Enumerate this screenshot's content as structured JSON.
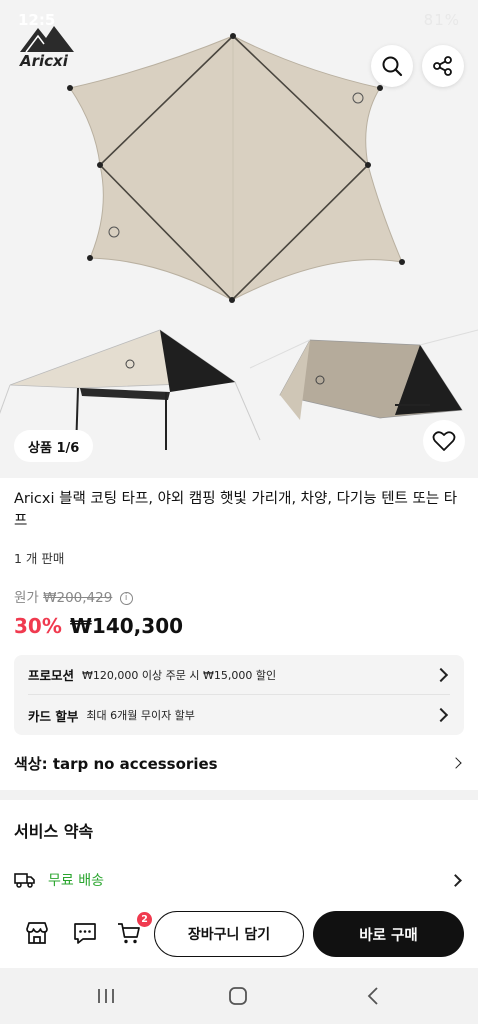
{
  "status_bar": {
    "time": "12:5",
    "right": "81%"
  },
  "brand": {
    "logo_text": "Aricxi"
  },
  "gallery": {
    "counter": "상품 1/6"
  },
  "product": {
    "title": "Aricxi 블랙 코팅 타프, 야외 캠핑 햇빛 가리개, 차양, 다기능 텐트 또는 타프",
    "sold": "1 개 판매",
    "original_label": "원가",
    "original_price": "₩200,429",
    "discount": "30%",
    "price": "₩140,300"
  },
  "promotions": [
    {
      "label": "프로모션",
      "text": "₩120,000 이상 주문 시 ₩15,000 할인"
    },
    {
      "label": "카드 할부",
      "text": "최대 6개월 무이자 할부"
    }
  ],
  "option": {
    "label": "색상: tarp no accessories"
  },
  "service": {
    "title": "서비스 약속",
    "shipping_label": "무료 배송"
  },
  "actions": {
    "cart_count": "2",
    "add_to_cart": "장바구니 담기",
    "buy_now": "바로 구매"
  },
  "icons": [
    "back-icon",
    "search-icon",
    "share-icon",
    "heart-icon",
    "store-icon",
    "chat-icon",
    "cart-icon",
    "truck-icon",
    "chevron-right-icon"
  ],
  "colors": {
    "accent": "#f03a4f",
    "green": "#2aa52e",
    "tarp": "#d9d0c1"
  }
}
